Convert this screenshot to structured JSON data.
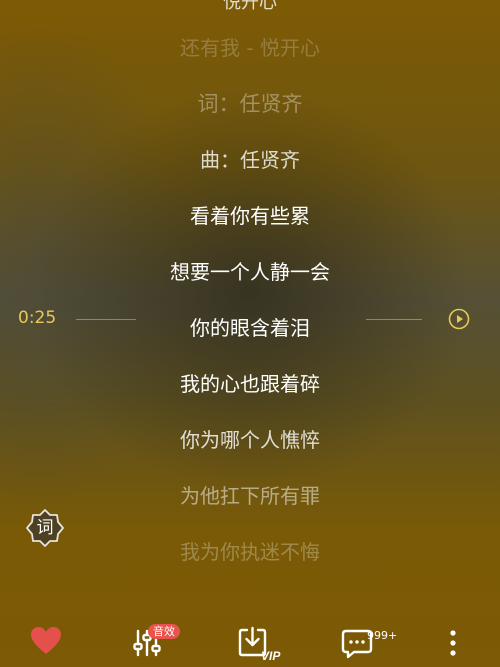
{
  "top_clip": "悦开心",
  "lyrics": [
    "还有我 - 悦开心",
    "词：任贤齐",
    "曲：任贤齐",
    "看着你有些累",
    "想要一个人静一会",
    "你的眼含着泪",
    "我的心也跟着碎",
    "你为哪个人憔悴",
    "为他扛下所有罪",
    "我为你执迷不悔"
  ],
  "player": {
    "time": "0:25",
    "lyric_toggle_label": "词"
  },
  "bottom_bar": {
    "effects_badge": "音效",
    "comment_count": "999+",
    "vip_label": "VIP"
  },
  "colors": {
    "accent_gold": "#e9c85a",
    "heart_red": "#e4504b",
    "badge_red": "#e9534d"
  }
}
